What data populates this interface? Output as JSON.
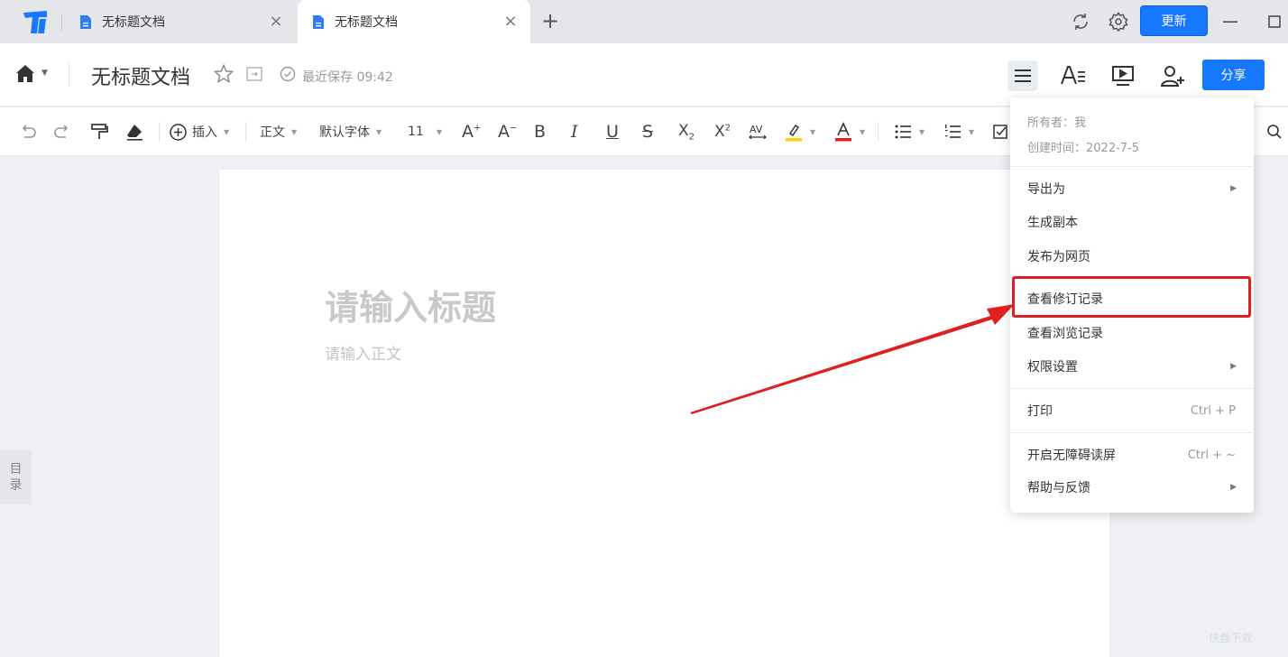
{
  "tabs": [
    {
      "label": "无标题文档",
      "active": false
    },
    {
      "label": "无标题文档",
      "active": true
    }
  ],
  "window": {
    "update_label": "更新"
  },
  "header": {
    "doc_title": "无标题文档",
    "saved_text": "最近保存 09:42",
    "share_label": "分享"
  },
  "toolbar": {
    "insert_label": "插入",
    "style_label": "正文",
    "font_label": "默认字体",
    "size_label": "11"
  },
  "document": {
    "title_placeholder": "请输入标题",
    "body_placeholder": "请输入正文"
  },
  "toc_label_1": "目",
  "toc_label_2": "录",
  "menu": {
    "owner": "所有者：我",
    "created": "创建时间：2022-7-5",
    "items": [
      {
        "label": "导出为",
        "has_submenu": true
      },
      {
        "label": "生成副本"
      },
      {
        "label": "发布为网页"
      },
      {
        "label": "查看修订记录",
        "highlighted": true
      },
      {
        "label": "查看浏览记录"
      },
      {
        "label": "权限设置",
        "has_submenu": true
      },
      {
        "label": "打印",
        "shortcut": "Ctrl + P"
      },
      {
        "label": "开启无障碍读屏",
        "shortcut": "Ctrl + ~"
      },
      {
        "label": "帮助与反馈",
        "has_submenu": true
      }
    ]
  },
  "colors": {
    "accent": "#1677ff",
    "annotation": "#e02020",
    "highlight_marker": "#f5d800",
    "font_color_marker": "#e02020"
  },
  "watermark": "快盘下载"
}
